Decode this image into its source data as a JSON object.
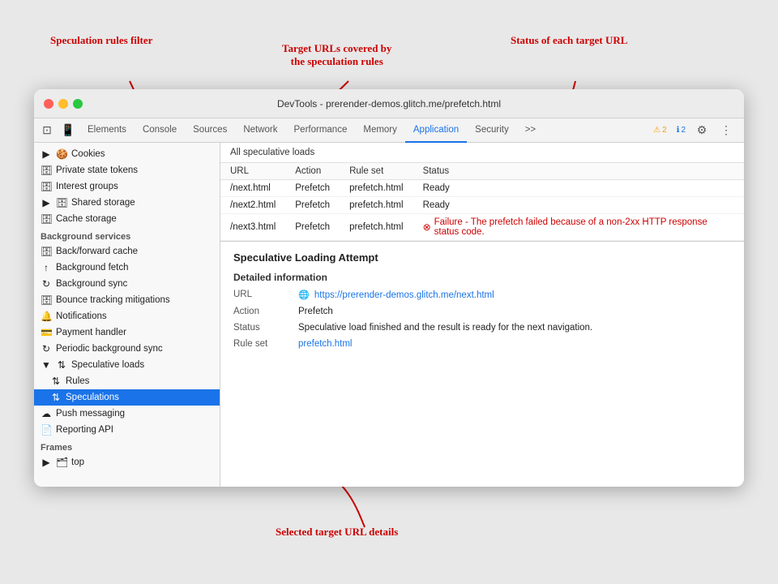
{
  "annotations": {
    "speculation_rules_filter": "Speculation rules filter",
    "target_urls": "Target URLs covered by\nthe speculation rules",
    "status_each": "Status of each target URL",
    "selected_details": "Selected target URL details"
  },
  "window": {
    "title": "DevTools - prerender-demos.glitch.me/prefetch.html"
  },
  "tabs": [
    {
      "label": "Elements",
      "active": false
    },
    {
      "label": "Console",
      "active": false
    },
    {
      "label": "Sources",
      "active": false
    },
    {
      "label": "Network",
      "active": false
    },
    {
      "label": "Performance",
      "active": false
    },
    {
      "label": "Memory",
      "active": false
    },
    {
      "label": "Application",
      "active": true
    },
    {
      "label": "Security",
      "active": false
    },
    {
      "label": ">>",
      "active": false
    }
  ],
  "badges": {
    "warn_count": "2",
    "info_count": "2"
  },
  "sidebar": {
    "sections": [
      {
        "items": [
          {
            "label": "Cookies",
            "icon": "▶ 🍪",
            "indent": 0
          },
          {
            "label": "Private state tokens",
            "icon": "🗄",
            "indent": 0
          },
          {
            "label": "Interest groups",
            "icon": "🗄",
            "indent": 0
          },
          {
            "label": "Shared storage",
            "icon": "▶ 🗄",
            "indent": 0
          },
          {
            "label": "Cache storage",
            "icon": "🗄",
            "indent": 0
          }
        ]
      },
      {
        "label": "Background services",
        "items": [
          {
            "label": "Back/forward cache",
            "icon": "🗄",
            "indent": 0
          },
          {
            "label": "Background fetch",
            "icon": "↑",
            "indent": 0
          },
          {
            "label": "Background sync",
            "icon": "↻",
            "indent": 0
          },
          {
            "label": "Bounce tracking mitigations",
            "icon": "🗄",
            "indent": 0
          },
          {
            "label": "Notifications",
            "icon": "🔔",
            "indent": 0
          },
          {
            "label": "Payment handler",
            "icon": "💳",
            "indent": 0
          },
          {
            "label": "Periodic background sync",
            "icon": "↻",
            "indent": 0
          },
          {
            "label": "Speculative loads",
            "icon": "▼ ↑↓",
            "indent": 0,
            "expanded": true
          },
          {
            "label": "Rules",
            "icon": "↑↓",
            "indent": 1
          },
          {
            "label": "Speculations",
            "icon": "↑↓",
            "indent": 1,
            "selected": true
          },
          {
            "label": "Push messaging",
            "icon": "☁",
            "indent": 0
          },
          {
            "label": "Reporting API",
            "icon": "📄",
            "indent": 0
          }
        ]
      },
      {
        "label": "Frames",
        "items": [
          {
            "label": "top",
            "icon": "▶ 🗂",
            "indent": 0
          }
        ]
      }
    ]
  },
  "main": {
    "speculative_header": "All speculative loads",
    "table": {
      "columns": [
        "URL",
        "Action",
        "Rule set",
        "Status"
      ],
      "rows": [
        {
          "url": "/next.html",
          "action": "Prefetch",
          "ruleset": "prefetch.html",
          "status": "Ready",
          "error": false,
          "selected": false
        },
        {
          "url": "/next2.html",
          "action": "Prefetch",
          "ruleset": "prefetch.html",
          "status": "Ready",
          "error": false,
          "selected": false
        },
        {
          "url": "/next3.html",
          "action": "Prefetch",
          "ruleset": "prefetch.html",
          "status": "Failure - The prefetch failed because of a non-2xx HTTP response status code.",
          "error": true,
          "selected": false
        }
      ]
    },
    "detail": {
      "title": "Speculative Loading Attempt",
      "subtitle": "Detailed information",
      "rows": [
        {
          "label": "URL",
          "value": "https://prerender-demos.glitch.me/next.html",
          "link": true
        },
        {
          "label": "Action",
          "value": "Prefetch",
          "link": false
        },
        {
          "label": "Status",
          "value": "Speculative load finished and the result is ready for the next navigation.",
          "link": false
        },
        {
          "label": "Rule set",
          "value": "prefetch.html",
          "link": true
        }
      ]
    }
  }
}
